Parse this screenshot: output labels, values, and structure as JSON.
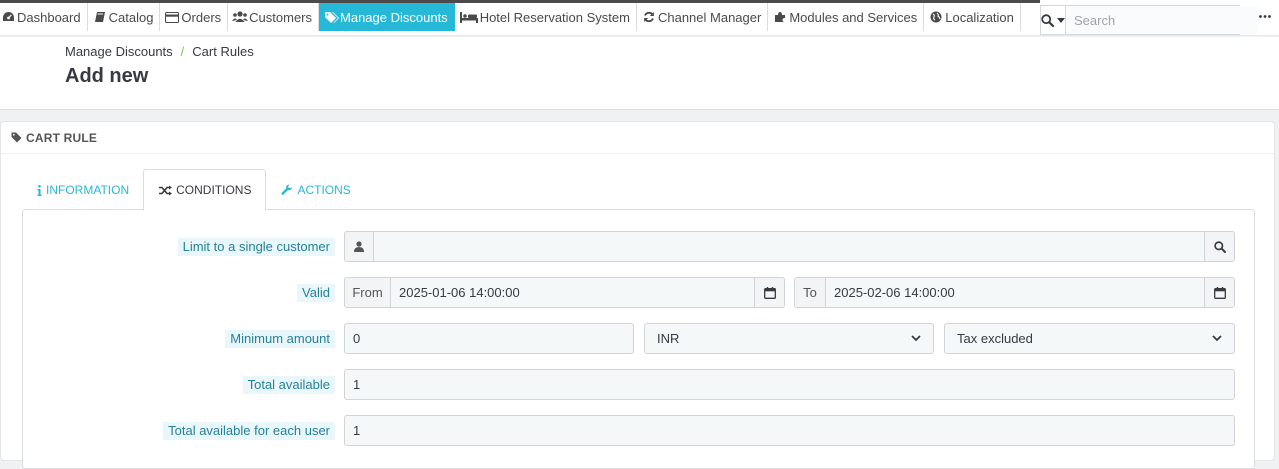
{
  "nav": {
    "items": [
      {
        "label": "Dashboard",
        "icon": "dashboard-icon"
      },
      {
        "label": "Catalog",
        "icon": "book-icon"
      },
      {
        "label": "Orders",
        "icon": "credit-card-icon"
      },
      {
        "label": "Customers",
        "icon": "users-icon"
      },
      {
        "label": "Manage Discounts",
        "icon": "tags-icon",
        "active": true
      },
      {
        "label": "Hotel Reservation System",
        "icon": "bed-icon"
      },
      {
        "label": "Channel Manager",
        "icon": "refresh-icon"
      },
      {
        "label": "Modules and Services",
        "icon": "puzzle-icon"
      },
      {
        "label": "Localization",
        "icon": "globe-icon"
      }
    ],
    "search_placeholder": "Search",
    "active_color": "#25b9d7"
  },
  "breadcrumb": {
    "parent": "Manage Discounts",
    "separator": "/",
    "current": "Cart Rules"
  },
  "page_title": "Add new",
  "panel": {
    "heading": "CART RULE",
    "tabs": [
      {
        "label": "INFORMATION",
        "icon": "info-icon"
      },
      {
        "label": "CONDITIONS",
        "icon": "shuffle-icon",
        "active": true
      },
      {
        "label": "ACTIONS",
        "icon": "wrench-icon"
      }
    ]
  },
  "form": {
    "customer": {
      "label": "Limit to a single customer",
      "value": ""
    },
    "valid": {
      "label": "Valid",
      "from_label": "From",
      "from_value": "2025-01-06 14:00:00",
      "to_label": "To",
      "to_value": "2025-02-06 14:00:00"
    },
    "minimum_amount": {
      "label": "Minimum amount",
      "value": "0",
      "currency": "INR",
      "tax": "Tax excluded"
    },
    "total_available": {
      "label": "Total available",
      "value": "1"
    },
    "total_per_user": {
      "label": "Total available for each user",
      "value": "1"
    }
  }
}
